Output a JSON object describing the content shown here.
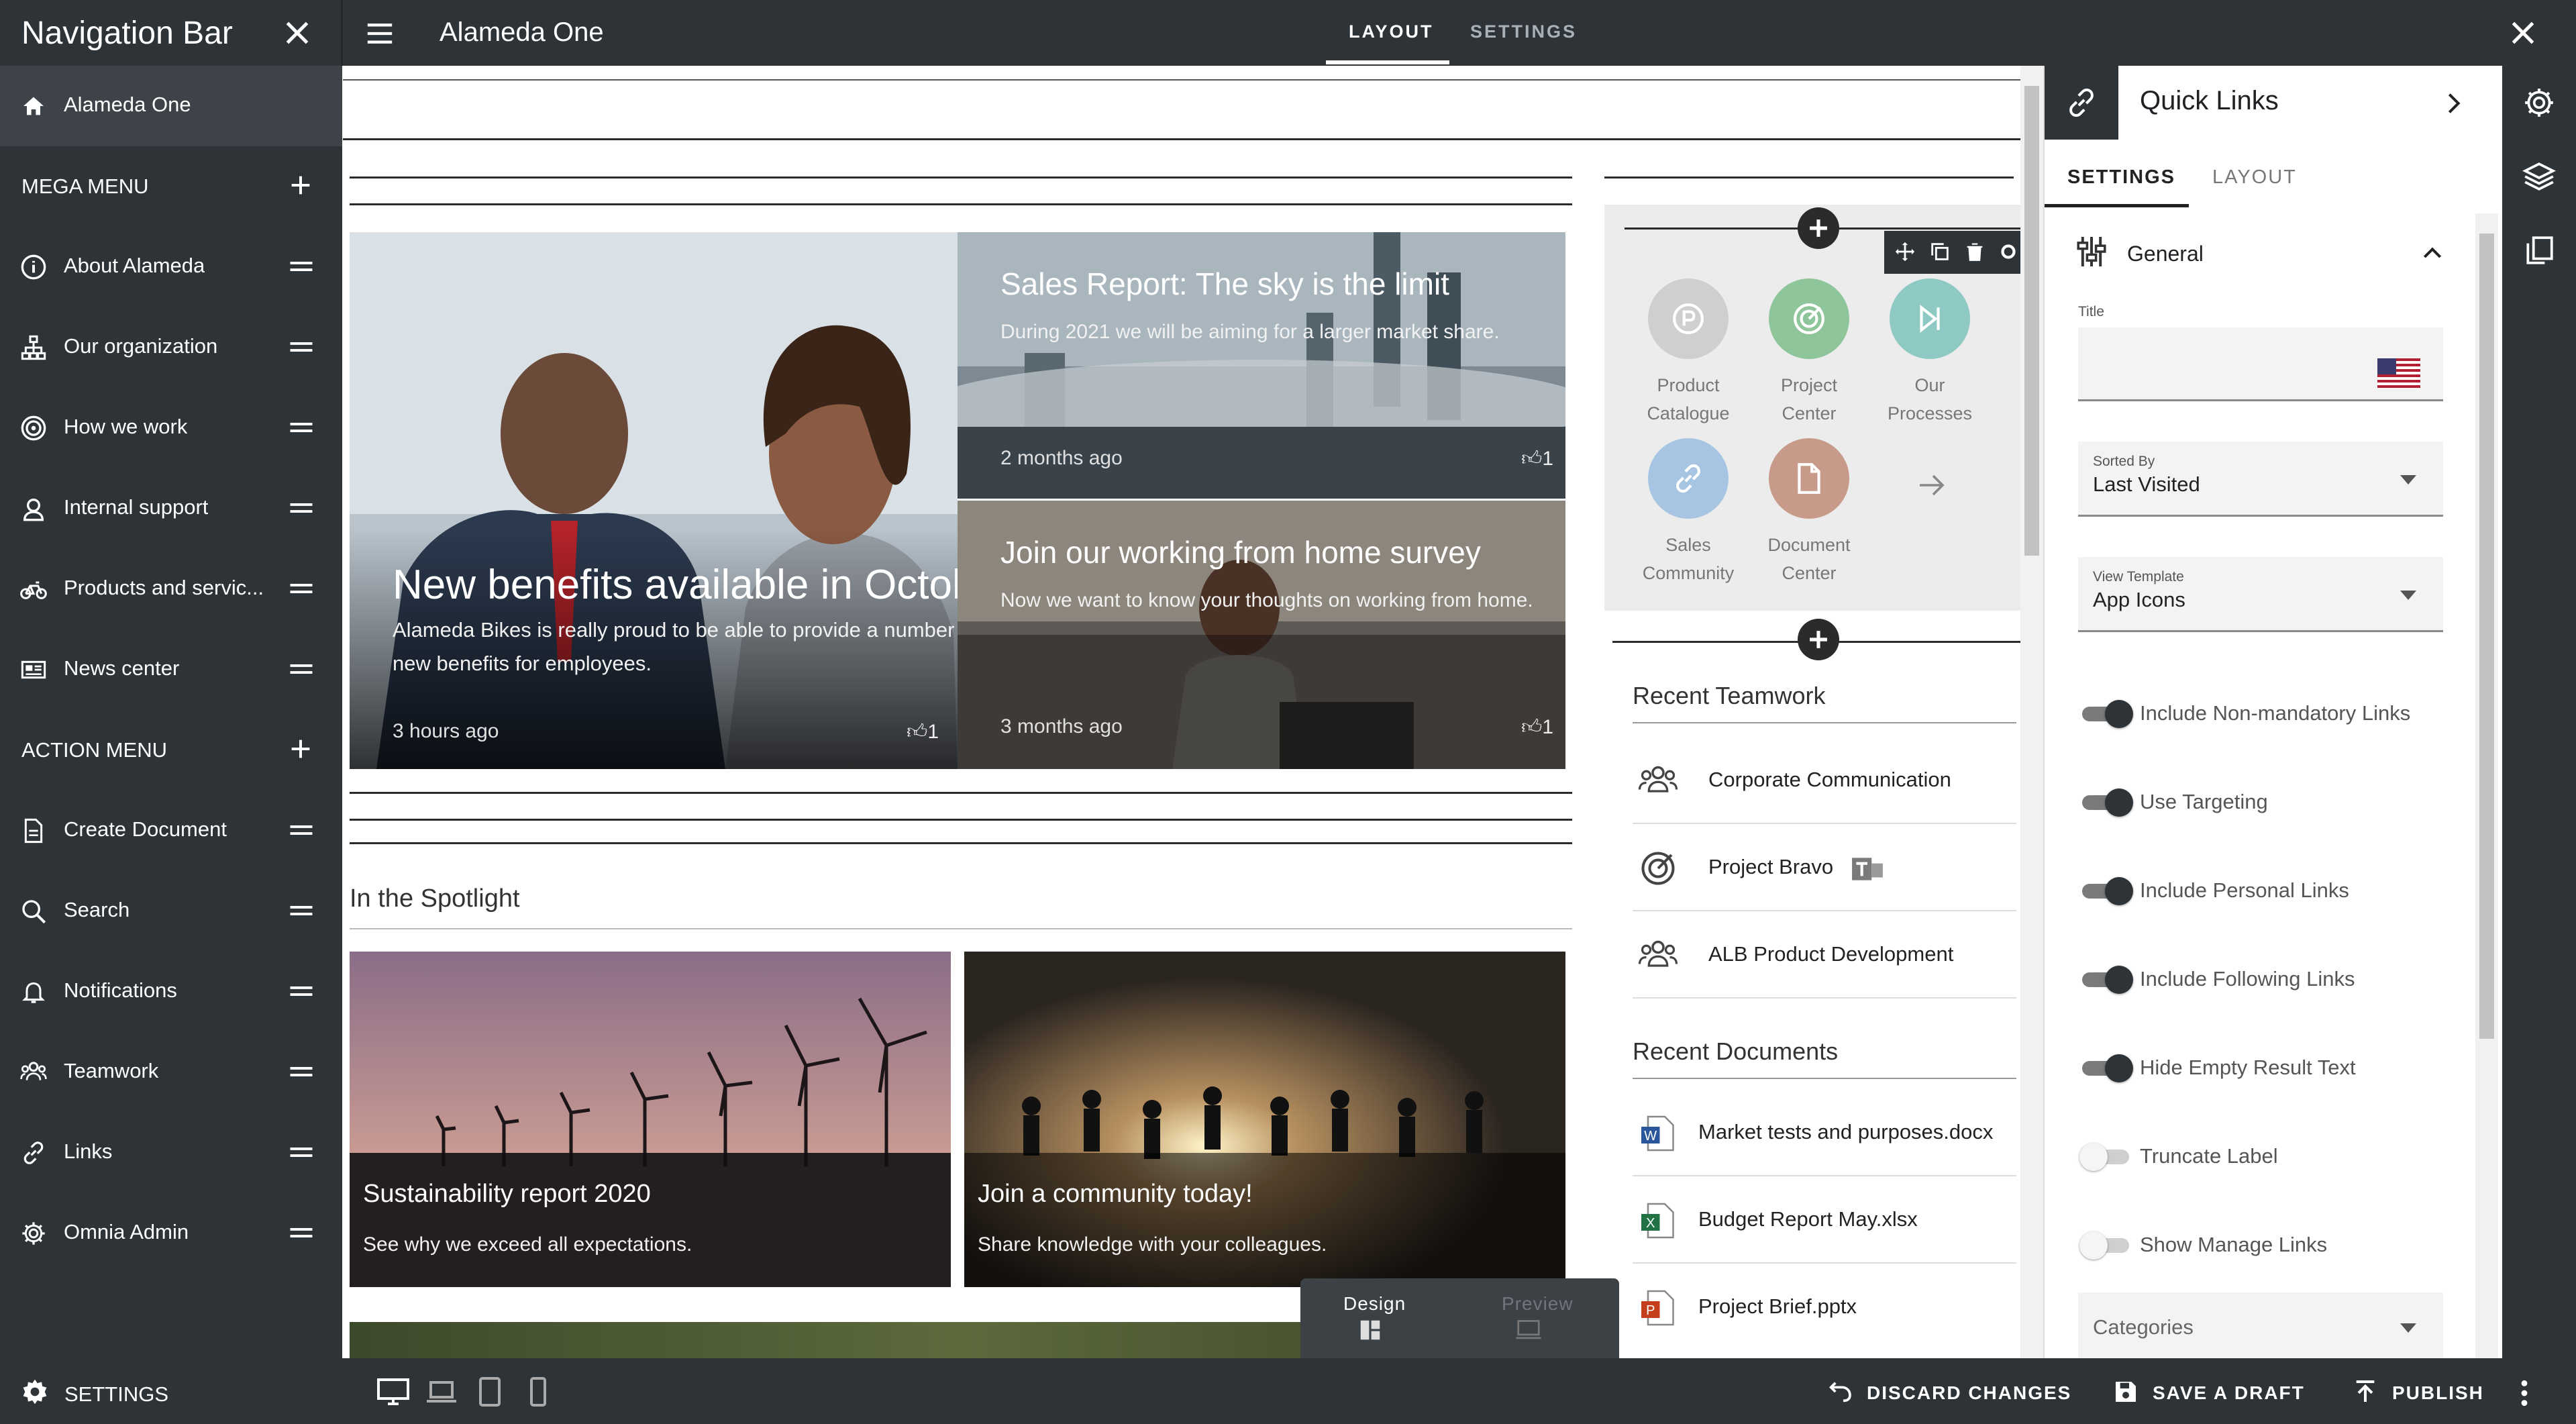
{
  "topbar": {
    "nav_title": "Navigation Bar",
    "site_title": "Alameda One",
    "tab_layout": "LAYOUT",
    "tab_settings": "SETTINGS"
  },
  "sidebar": {
    "home": "Alameda One",
    "mega_menu": "MEGA MENU",
    "mega_items": [
      "About Alameda",
      "Our organization",
      "How we work",
      "Internal support",
      "Products and servic...",
      "News center"
    ],
    "action_menu": "ACTION MENU",
    "action_items": [
      "Create Document",
      "Search",
      "Notifications",
      "Teamwork",
      "Links",
      "Omnia Admin"
    ]
  },
  "news": {
    "tiles": [
      {
        "title": "New benefits available in October",
        "desc_line1": "Alameda Bikes is really proud to be able to provide a number of",
        "desc_line2": "new benefits for employees.",
        "ago": "3 hours ago",
        "likes": "1"
      },
      {
        "title": "Sales Report: The sky is the limit",
        "desc": "During 2021 we will be aiming for a larger market share.",
        "ago": "2 months ago",
        "likes": "1"
      },
      {
        "title": "Join our working from home survey",
        "desc": "Now we want to know your thoughts on working from home.",
        "ago": "3 months ago",
        "likes": "1"
      }
    ]
  },
  "spotlight": {
    "title": "In the Spotlight",
    "cards": [
      {
        "title": "Sustainability report 2020",
        "desc": "See why we exceed all expectations."
      },
      {
        "title": "Join a community today!",
        "desc": "Share knowledge with your colleagues."
      }
    ]
  },
  "quick_links_apps": [
    {
      "line1": "Product",
      "line2": "Catalogue",
      "color": "#cfcfcf"
    },
    {
      "line1": "Project",
      "line2": "Center",
      "color": "#8fc59a"
    },
    {
      "line1": "Our",
      "line2": "Processes",
      "color": "#8fc9c4"
    },
    {
      "line1": "Sales",
      "line2": "Community",
      "color": "#a7c5e3"
    },
    {
      "line1": "Document",
      "line2": "Center",
      "color": "#c79a8a"
    }
  ],
  "recent_teamwork": {
    "title": "Recent Teamwork",
    "items": [
      "Corporate Communication",
      "Project Bravo",
      "ALB Product Development"
    ]
  },
  "recent_documents": {
    "title": "Recent Documents",
    "items": [
      "Market tests and purposes.docx",
      "Budget Report May.xlsx",
      "Project Brief.pptx"
    ]
  },
  "design_preview": {
    "design": "Design",
    "preview": "Preview"
  },
  "panel": {
    "title": "Quick Links",
    "tab_settings": "SETTINGS",
    "tab_layout": "LAYOUT",
    "section": "General",
    "title_caption": "Title",
    "sorted_by_caption": "Sorted By",
    "sorted_by_value": "Last Visited",
    "view_template_caption": "View Template",
    "view_template_value": "App Icons",
    "toggles": [
      {
        "label": "Include Non-mandatory Links",
        "on": true
      },
      {
        "label": "Use Targeting",
        "on": true
      },
      {
        "label": "Include Personal Links",
        "on": true
      },
      {
        "label": "Include Following Links",
        "on": true
      },
      {
        "label": "Hide Empty Result Text",
        "on": true
      },
      {
        "label": "Truncate Label",
        "on": false
      },
      {
        "label": "Show Manage Links",
        "on": false
      }
    ],
    "categories_caption": "Categories"
  },
  "bottombar": {
    "settings": "SETTINGS",
    "discard": "DISCARD CHANGES",
    "draft": "SAVE A DRAFT",
    "publish": "PUBLISH"
  }
}
